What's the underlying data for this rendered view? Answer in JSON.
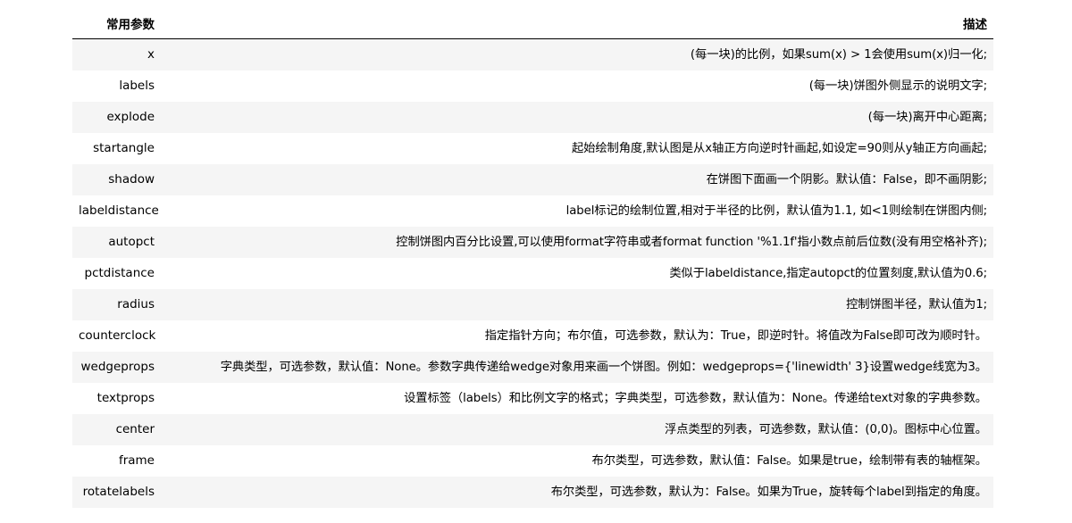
{
  "table": {
    "headers": {
      "param": "常用参数",
      "desc": "描述"
    },
    "rows": [
      {
        "param": "x",
        "desc": "(每一块)的比例，如果sum(x) > 1会使用sum(x)归一化;"
      },
      {
        "param": "labels",
        "desc": "(每一块)饼图外侧显示的说明文字;"
      },
      {
        "param": "explode",
        "desc": "(每一块)离开中心距离;"
      },
      {
        "param": "startangle",
        "desc": "起始绘制角度,默认图是从x轴正方向逆时针画起,如设定=90则从y轴正方向画起;"
      },
      {
        "param": "shadow",
        "desc": "在饼图下面画一个阴影。默认值：False，即不画阴影;"
      },
      {
        "param": "labeldistance",
        "desc": "label标记的绘制位置,相对于半径的比例，默认值为1.1, 如<1则绘制在饼图内侧;"
      },
      {
        "param": "autopct",
        "desc": "控制饼图内百分比设置,可以使用format字符串或者format function '%1.1f'指小数点前后位数(没有用空格补齐);"
      },
      {
        "param": "pctdistance",
        "desc": "类似于labeldistance,指定autopct的位置刻度,默认值为0.6;"
      },
      {
        "param": "radius",
        "desc": "控制饼图半径，默认值为1;"
      },
      {
        "param": "counterclock",
        "desc": "指定指针方向；布尔值，可选参数，默认为：True，即逆时针。将值改为False即可改为顺时针。"
      },
      {
        "param": "wedgeprops",
        "desc": "字典类型，可选参数，默认值：None。参数字典传递给wedge对象用来画一个饼图。例如：wedgeprops={'linewidth' 3}设置wedge线宽为3。"
      },
      {
        "param": "textprops",
        "desc": "设置标签（labels）和比例文字的格式；字典类型，可选参数，默认值为：None。传递给text对象的字典参数。"
      },
      {
        "param": "center",
        "desc": "浮点类型的列表，可选参数，默认值：(0,0)。图标中心位置。"
      },
      {
        "param": "frame",
        "desc": "布尔类型，可选参数，默认值：False。如果是true，绘制带有表的轴框架。"
      },
      {
        "param": "rotatelabels",
        "desc": "布尔类型，可选参数，默认为：False。如果为True，旋转每个label到指定的角度。"
      }
    ]
  }
}
